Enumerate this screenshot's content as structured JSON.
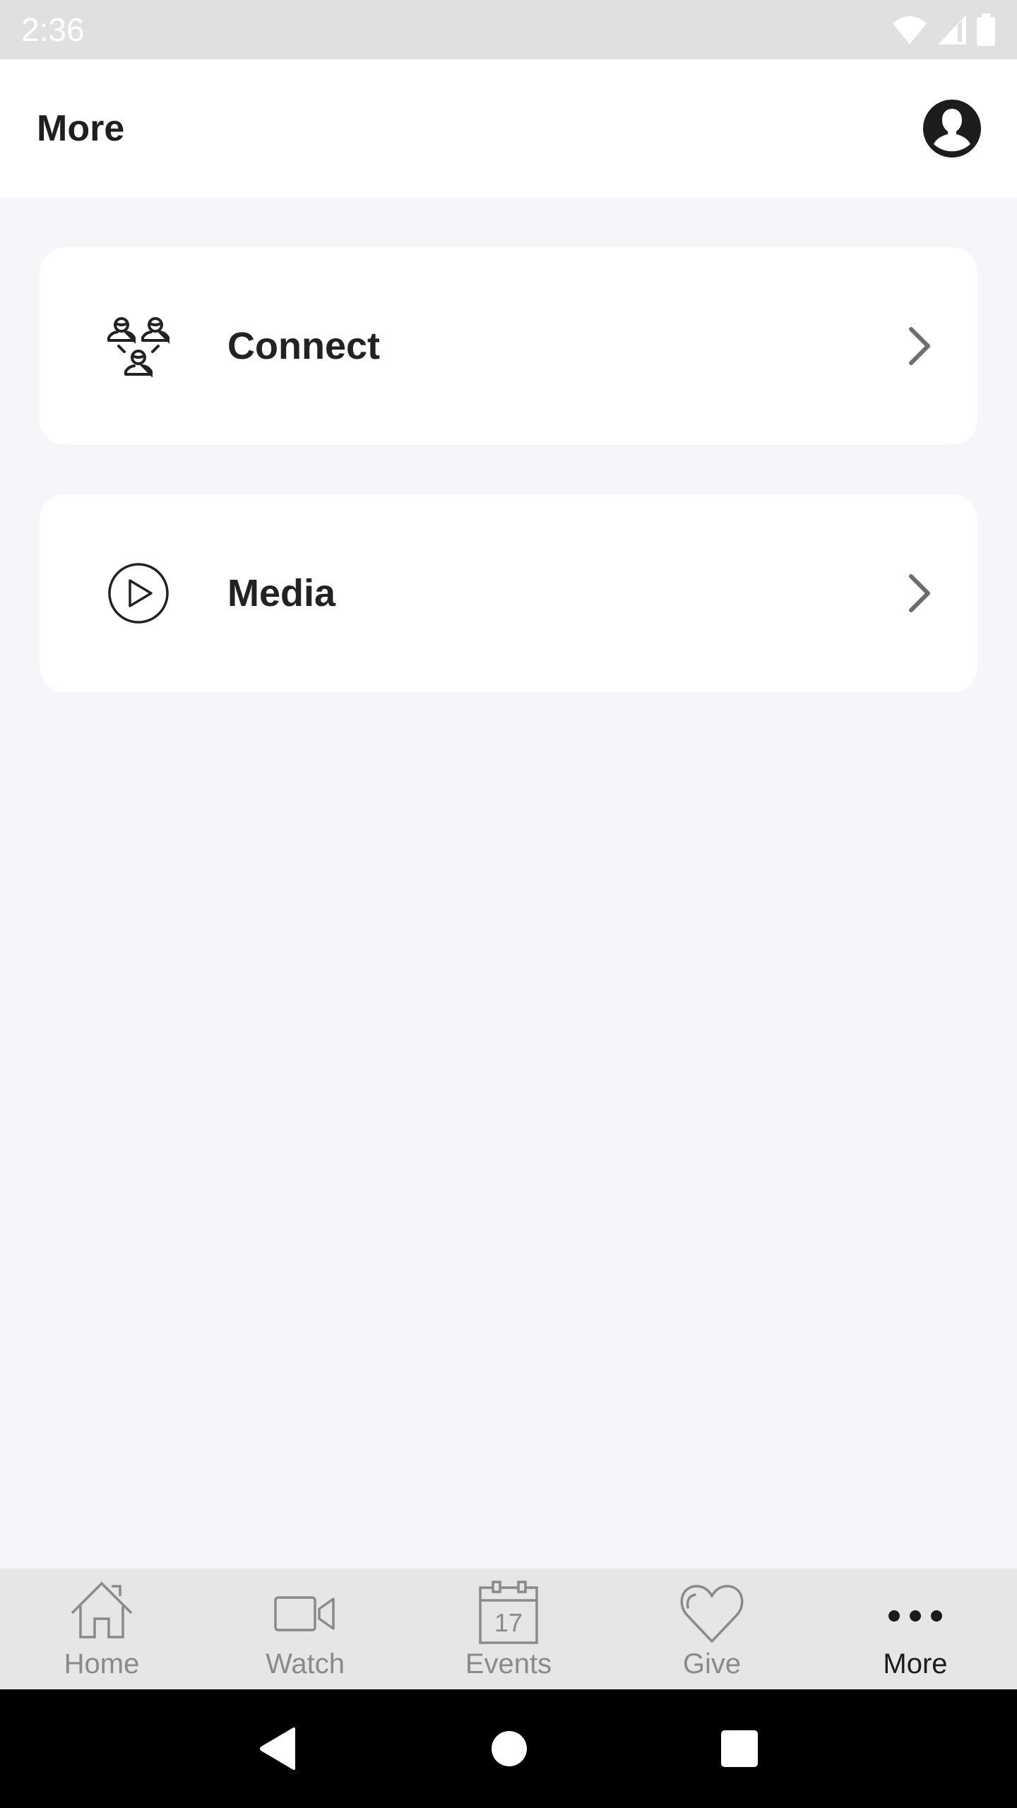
{
  "status_bar": {
    "time": "2:36",
    "icons": [
      "wifi-icon",
      "cellular-signal-icon",
      "battery-icon"
    ]
  },
  "header": {
    "title": "More",
    "profile_icon": "account-circle-icon"
  },
  "menu": {
    "items": [
      {
        "label": "Connect",
        "icon": "people-network-icon",
        "trailing_icon": "chevron-right-icon"
      },
      {
        "label": "Media",
        "icon": "play-circle-icon",
        "trailing_icon": "chevron-right-icon"
      }
    ]
  },
  "bottom_nav": {
    "items": [
      {
        "label": "Home",
        "icon": "home-icon",
        "active": false
      },
      {
        "label": "Watch",
        "icon": "video-camera-icon",
        "active": false
      },
      {
        "label": "Events",
        "icon": "calendar-icon",
        "calendar_day": "17",
        "active": false
      },
      {
        "label": "Give",
        "icon": "heart-icon",
        "active": false
      },
      {
        "label": "More",
        "icon": "more-horizontal-icon",
        "active": true
      }
    ]
  },
  "system_nav": {
    "buttons": [
      "back-icon",
      "home-circle-icon",
      "recents-square-icon"
    ]
  },
  "colors": {
    "background": "#f4f6f9",
    "card": "#ffffff",
    "text_primary": "#222222",
    "nav_inactive": "#8a8a8a",
    "nav_active": "#1c1c1c",
    "status_bar": "#e0e0e0"
  }
}
